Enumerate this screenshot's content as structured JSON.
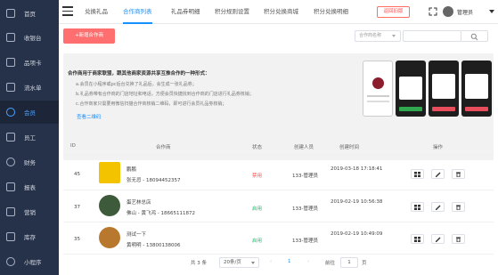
{
  "sidebar": {
    "items": [
      {
        "label": "首页",
        "icon": "monitor-icon",
        "active": false
      },
      {
        "label": "收银台",
        "icon": "cashier-icon",
        "active": false
      },
      {
        "label": "品项卡",
        "icon": "card-icon",
        "active": false
      },
      {
        "label": "流水单",
        "icon": "document-icon",
        "active": false
      },
      {
        "label": "会员",
        "icon": "heart-icon",
        "active": true
      },
      {
        "label": "员工",
        "icon": "staff-icon",
        "active": false
      },
      {
        "label": "财务",
        "icon": "finance-icon",
        "active": false
      },
      {
        "label": "报表",
        "icon": "report-icon",
        "active": false
      },
      {
        "label": "营销",
        "icon": "marketing-icon",
        "active": false
      },
      {
        "label": "库存",
        "icon": "box-icon",
        "active": false
      },
      {
        "label": "小程序",
        "icon": "mini-program-icon",
        "active": false
      }
    ]
  },
  "header": {
    "tabs": [
      {
        "label": "兑换礼品",
        "active": false
      },
      {
        "label": "合作商列表",
        "active": true
      },
      {
        "label": "礼品券明细",
        "active": false
      },
      {
        "label": "积分规则设置",
        "active": false
      },
      {
        "label": "积分兑换商城",
        "active": false
      },
      {
        "label": "积分兑换明细",
        "active": false
      }
    ],
    "back_label": "返回旧版",
    "user_name": "管理员"
  },
  "toolbar": {
    "add_label": "+新增合作商",
    "filter_placeholder": "合作商名称"
  },
  "info": {
    "title": "合作商用于商家联盟，跟其他商家资源共享互推合作的一种形式：",
    "lines": [
      "a.会员在小程序或pc后台兑换了礼品后，会生成一张礼品劵；",
      "b.礼品劵带有合作商的门店地址和电话，方便会员快捷找到合作商的门店进行礼品劵核销；",
      "c.合作商家只需要用微信扫描合作商核销二维码，即可进行会员礼品劵核销；"
    ],
    "qr_link": "查看二维码"
  },
  "table": {
    "headers": [
      "ID",
      "合作商",
      "状态",
      "创建人员",
      "创建时间",
      "操作"
    ],
    "rows": [
      {
        "id": "45",
        "name": "鹏鹏",
        "contact": "张无忌 - 18094452357",
        "status": "禁用",
        "creator": "133-管理员",
        "time": "2019-03-18 17:18:41"
      },
      {
        "id": "37",
        "name": "蛋艺林总店",
        "contact": "佛山 - 黄飞鸿 - 18665111872",
        "status": "启用",
        "creator": "133-管理员",
        "time": "2019-02-19 10:56:38"
      },
      {
        "id": "35",
        "name": "测试一下",
        "contact": "黄明明 - 13800138006",
        "status": "启用",
        "creator": "133-管理员",
        "time": "2019-02-19 10:49:09"
      }
    ]
  },
  "pager": {
    "total": "共 3 条",
    "page_size": "20条/页",
    "current": "1",
    "goto_label": "前往",
    "goto_value": "1",
    "page_unit": "页"
  },
  "colors": {
    "sidebar_bg": "#26324a",
    "accent": "#1890ff",
    "danger": "#ff4d4f",
    "success": "#19be6b",
    "add_button": "#ff6f6f"
  }
}
